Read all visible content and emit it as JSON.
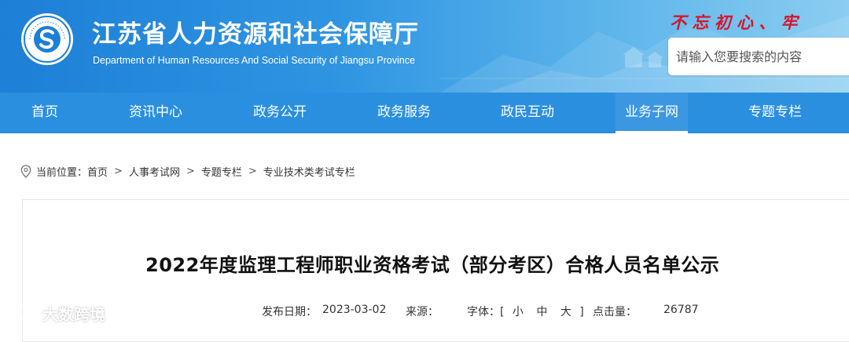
{
  "header": {
    "title": "江苏省人力资源和社会保障厅",
    "subtitle": "Department of Human Resources And Social Security of Jiangsu Province",
    "slogan": "不 忘 初 心  、 牢",
    "emblem_text": "江苏省人力资源和社会保障厅"
  },
  "search": {
    "placeholder": "请输入您要搜索的内容"
  },
  "nav": {
    "items": [
      {
        "label": "首页"
      },
      {
        "label": "资讯中心"
      },
      {
        "label": "政务公开"
      },
      {
        "label": "政务服务"
      },
      {
        "label": "政民互动"
      },
      {
        "label": "业务子网"
      },
      {
        "label": "专题专栏"
      }
    ],
    "active_index": 5
  },
  "breadcrumb": {
    "prefix": "当前位置：",
    "items": [
      "首页",
      "人事考试网",
      "专题专栏",
      "专业技术类考试专栏"
    ]
  },
  "article": {
    "title": "2022年度监理工程师职业资格考试（部分考区）合格人员名单公示",
    "publish_label": "发布日期：",
    "publish_date": "2023-03-02",
    "source_label": "来源：",
    "font_label": "字体：[",
    "font_small": "小",
    "font_medium": "中",
    "font_large": "大",
    "font_close": "]",
    "views_label": "点击量：",
    "views": "26787"
  },
  "watermark": {
    "text": "大数跨境"
  },
  "colors": {
    "header_blue": "#1d7fd6",
    "nav_blue": "#2b8fe0",
    "slogan_red": "#d6162a"
  },
  "icons": {
    "location": "location-pin-icon",
    "emblem": "emblem-icon"
  }
}
